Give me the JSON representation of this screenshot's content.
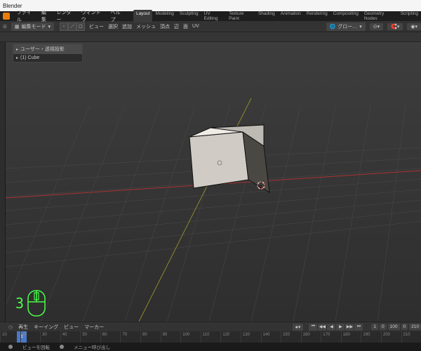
{
  "title": "Blender",
  "menu": {
    "file": "ファイル",
    "edit": "編集",
    "render": "レンダー",
    "window": "ウィンドウ",
    "help": "ヘルプ"
  },
  "workspaces": [
    "Layout",
    "Modeling",
    "Sculpting",
    "UV Editing",
    "Texture Paint",
    "Shading",
    "Animation",
    "Rendering",
    "Compositing",
    "Geometry Nodes",
    "Scripting"
  ],
  "active_workspace": "Layout",
  "mode": "編集モード",
  "header": {
    "view": "ビュー",
    "select": "選択",
    "add": "追加",
    "mesh": "メッシュ",
    "vertex": "頂点",
    "edge": "辺",
    "face": "面",
    "uv": "UV"
  },
  "header_right": {
    "global": "グロー…"
  },
  "hierarchy": {
    "top": "ユーザー・透視投影",
    "obj": "(1) Cube"
  },
  "mouse_count": "3",
  "timeline_menu": {
    "playback": "再生",
    "keying": "キーイング",
    "view": "ビュー",
    "marker": "マーカー"
  },
  "frame": {
    "current": "1",
    "fields": [
      "0",
      "100",
      "0",
      "210"
    ],
    "ticks": [
      "10",
      "20",
      "30",
      "40",
      "50",
      "60",
      "70",
      "80",
      "90",
      "100",
      "110",
      "120",
      "130",
      "140",
      "150",
      "160",
      "170",
      "180",
      "190",
      "200",
      "210"
    ]
  },
  "status": {
    "rotate": "ビューを回転",
    "menu_prefix": "メニュー呼び出し"
  }
}
